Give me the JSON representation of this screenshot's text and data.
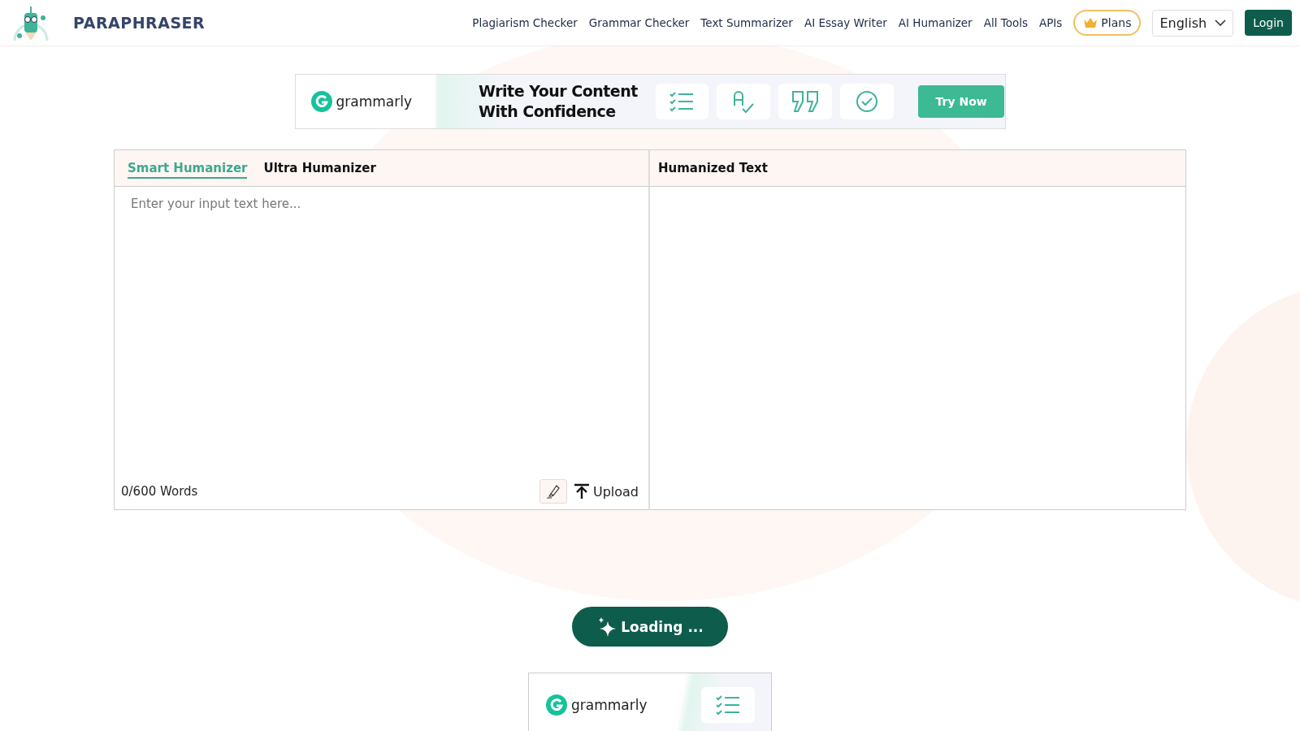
{
  "header": {
    "brand": "PARAPHRASER",
    "nav": [
      "Plagiarism Checker",
      "Grammar Checker",
      "Text Summarizer",
      "AI Essay Writer",
      "AI Humanizer",
      "All Tools",
      "APIs"
    ],
    "plans": "Plans",
    "language": "English",
    "login": "Login"
  },
  "ad_banner": {
    "brand": "grammarly",
    "headline": "Write Your Content With Confidence",
    "cta": "Try Now"
  },
  "editor": {
    "tabs": [
      {
        "label": "Smart Humanizer",
        "selected": true
      },
      {
        "label": "Ultra Humanizer",
        "selected": false
      }
    ],
    "placeholder": "Enter your input text here...",
    "word_count": "0/600 Words",
    "upload": "Upload",
    "output_title": "Humanized Text"
  },
  "action_button": "Loading ...",
  "bottom_ad": {
    "brand": "grammarly"
  }
}
